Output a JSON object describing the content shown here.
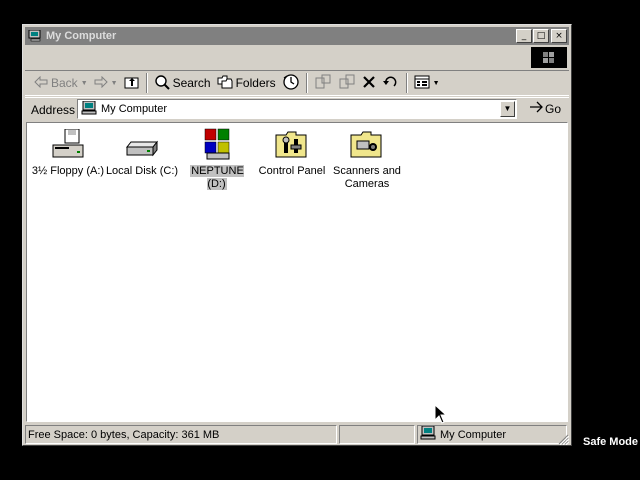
{
  "window": {
    "title": "My Computer",
    "buttons": {
      "minimize": "_",
      "maximize": "□",
      "close": "×"
    }
  },
  "toolbar": {
    "back_label": "Back",
    "search_label": "Search",
    "folders_label": "Folders"
  },
  "address": {
    "label": "Address",
    "value": "My Computer",
    "go_label": "Go"
  },
  "items": [
    {
      "label": "3½ Floppy (A:)",
      "icon": "floppy-drive-icon"
    },
    {
      "label": "Local Disk (C:)",
      "icon": "hard-disk-icon"
    },
    {
      "label": "NEPTUNE (D:)",
      "icon": "cd-drive-windows-icon",
      "selected": true
    },
    {
      "label": "Control Panel",
      "icon": "control-panel-folder-icon"
    },
    {
      "label": "Scanners and Cameras",
      "icon": "scanners-cameras-folder-icon"
    }
  ],
  "status": {
    "space": "Free Space: 0 bytes, Capacity: 361 MB",
    "zone": "My Computer"
  },
  "overlay": {
    "mode": "Safe Mode"
  },
  "colors": {
    "titlebar_inactive": "#808080",
    "face": "#d4d0c8",
    "desktop": "#000000"
  }
}
